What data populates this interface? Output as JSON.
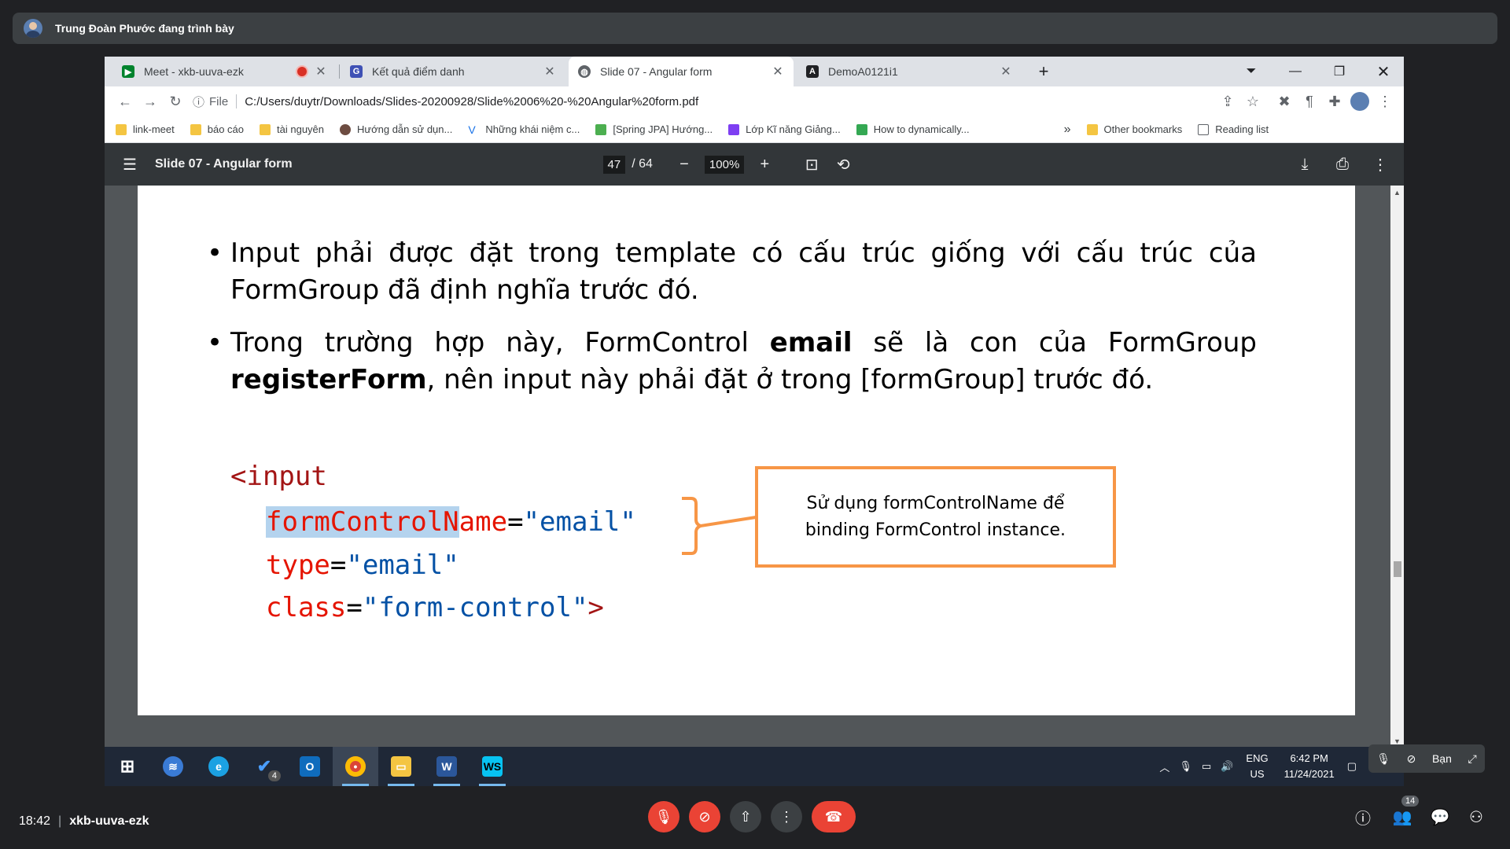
{
  "presenter": {
    "text": "Trung Đoàn Phước đang trình bày"
  },
  "tabs": [
    {
      "title": "Meet - xkb-uuva-ezk",
      "icon": "google-meet-icon",
      "recording": true
    },
    {
      "title": "Kết quả điểm danh",
      "icon": "g-form-icon"
    },
    {
      "title": "Slide 07 - Angular form",
      "icon": "globe-icon",
      "active": true
    },
    {
      "title": "DemoA0121i1",
      "icon": "angular-icon"
    }
  ],
  "address": {
    "scheme": "File",
    "url": "C:/Users/duytr/Downloads/Slides-20200928/Slide%2006%20-%20Angular%20form.pdf"
  },
  "bookmarks": [
    {
      "label": "link-meet"
    },
    {
      "label": "báo cáo"
    },
    {
      "label": "tài nguyên"
    },
    {
      "label": "Hướng dẫn sử dụn..."
    },
    {
      "label": "Những khái niệm c..."
    },
    {
      "label": "[Spring JPA] Hướng..."
    },
    {
      "label": "Lớp Kĩ năng Giảng..."
    },
    {
      "label": "How to dynamically..."
    }
  ],
  "bookmarks_more": "»",
  "other_bookmarks": "Other bookmarks",
  "reading_list": "Reading list",
  "pdf": {
    "title": "Slide 07 - Angular form",
    "page": "47",
    "total": "/ 64",
    "zoom": "100%"
  },
  "slide": {
    "bullet1": "Input phải được đặt trong template có cấu trúc giống với cấu trúc của FormGroup đã định nghĩa trước đó.",
    "bullet2_a": "Trong trường hợp này, FormControl ",
    "bullet2_b": "email",
    "bullet2_c": " sẽ là con của FormGroup ",
    "bullet2_d": "registerForm",
    "bullet2_e": ", nên input này phải đặt ở trong [formGroup] trước đó.",
    "code_tag": "<input",
    "code_attr1_hl": "formControlN",
    "code_attr1_rest": "ame",
    "code_attr2": "type",
    "code_attr3": "class",
    "eq": "=",
    "val1": "\"email\"",
    "val2": "\"email\"",
    "val3": "\"form-control\"",
    "close": ">",
    "callout": "Sử dụng formControlName để binding FormControl instance."
  },
  "taskbar": {
    "badge_count": "4",
    "lang": "ENG",
    "region": "US",
    "time": "6:42 PM",
    "date": "11/24/2021"
  },
  "floating": {
    "label": "Bạn"
  },
  "meet": {
    "time": "18:42",
    "code": "xkb-uuva-ezk",
    "people_count": "14"
  }
}
